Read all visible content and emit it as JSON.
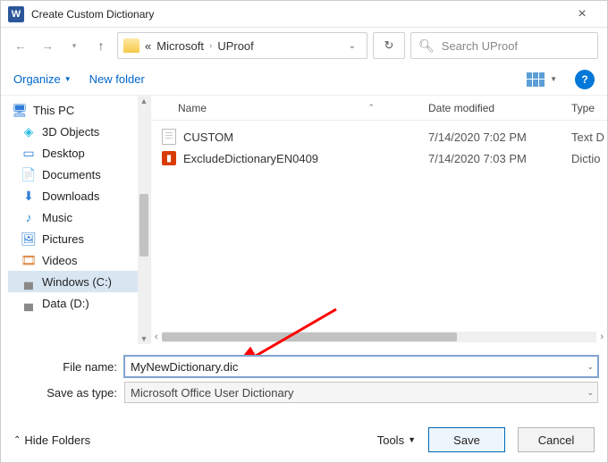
{
  "titlebar": {
    "title": "Create Custom Dictionary"
  },
  "nav": {
    "crumb_prefix": "«",
    "crumb1": "Microsoft",
    "crumb2": "UProof",
    "refresh_icon": "↻"
  },
  "search": {
    "placeholder": "Search UProof"
  },
  "toolbar": {
    "organize": "Organize",
    "newfolder": "New folder"
  },
  "tree": {
    "this_pc": "This PC",
    "items": [
      "3D Objects",
      "Desktop",
      "Documents",
      "Downloads",
      "Music",
      "Pictures",
      "Videos",
      "Windows (C:)",
      "Data (D:)"
    ]
  },
  "columns": {
    "name": "Name",
    "modified": "Date modified",
    "type": "Type"
  },
  "files": [
    {
      "name": "CUSTOM",
      "modified": "7/14/2020 7:02 PM",
      "type": "Text D"
    },
    {
      "name": "ExcludeDictionaryEN0409",
      "modified": "7/14/2020 7:03 PM",
      "type": "Dictio"
    }
  ],
  "form": {
    "filename_label": "File name:",
    "filename_value": "MyNewDictionary.dic",
    "savetype_label": "Save as type:",
    "savetype_value": "Microsoft Office User Dictionary"
  },
  "footer": {
    "hide": "Hide Folders",
    "tools": "Tools",
    "save": "Save",
    "cancel": "Cancel"
  }
}
